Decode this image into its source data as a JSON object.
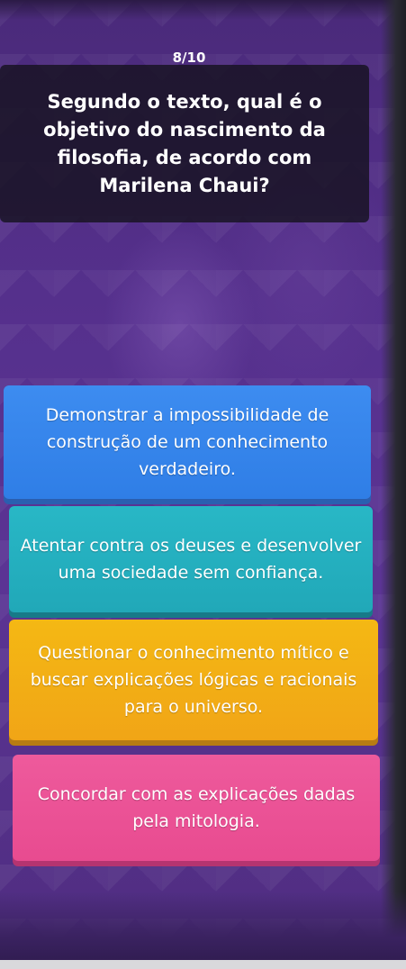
{
  "quiz": {
    "progress": "8/10",
    "question": "Segundo o texto, qual é o objetivo do nascimento da filosofia, de acordo com Marilena Chaui?",
    "options": [
      {
        "label": "Demonstrar a impossibilidade de construção de um conhecimento verdadeiro.",
        "color": "#3d8cf0"
      },
      {
        "label": "Atentar contra os deuses e desenvolver uma sociedade sem confiança.",
        "color": "#28b7c6"
      },
      {
        "label": "Questionar o conhecimento mítico e buscar explicações lógicas e racionais para o universo.",
        "color": "#f4b814"
      },
      {
        "label": "Concordar com as explicações dadas pela mitologia.",
        "color": "#ee5a9c"
      }
    ]
  },
  "theme": {
    "background": "#55308c",
    "question_box": "#16121f"
  }
}
